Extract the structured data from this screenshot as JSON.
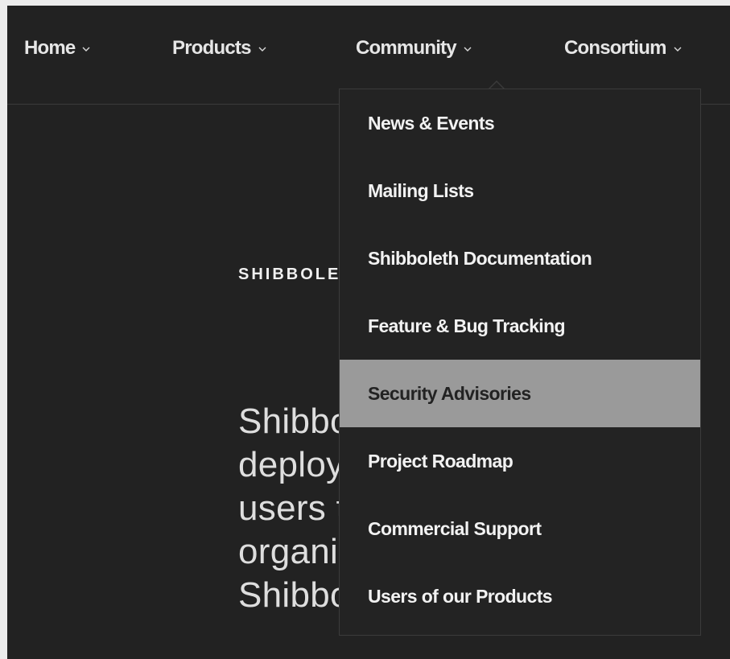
{
  "nav": {
    "items": [
      {
        "label": "Home"
      },
      {
        "label": "Products"
      },
      {
        "label": "Community"
      },
      {
        "label": "Consortium"
      }
    ]
  },
  "content": {
    "eyebrow": "SHIBBOLETH",
    "hero_lines": [
      "Shibboleth is world",
      "deploying authenti",
      "users the ability t",
      "organizations netw",
      "Shibboleth system is free"
    ]
  },
  "dropdown": {
    "items": [
      {
        "label": "News & Events"
      },
      {
        "label": "Mailing Lists"
      },
      {
        "label": "Shibboleth Documentation"
      },
      {
        "label": "Feature & Bug Tracking"
      },
      {
        "label": "Security Advisories",
        "active": true
      },
      {
        "label": "Project Roadmap"
      },
      {
        "label": "Commercial Support"
      },
      {
        "label": "Users of our Products"
      }
    ]
  },
  "colors": {
    "background": "#222222",
    "frame": "#ececec",
    "text": "#e6e6e6",
    "hover": "#9a9a9a"
  },
  "icons": {
    "nav_chevron": "chevron-down-icon",
    "menu_pointer": "dropdown-arrow-icon"
  }
}
